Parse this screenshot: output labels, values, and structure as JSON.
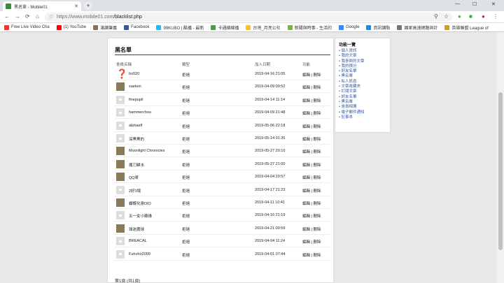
{
  "browser": {
    "tab_title": "黑名單 - Mobile01",
    "tab_close": "✕",
    "new_tab": "+",
    "url_host": "https://www.mobile01.com",
    "url_path": "/blacklist.php",
    "win_min": "—",
    "win_max": "☐",
    "win_close": "✕",
    "back": "←",
    "forward": "→",
    "reload": "⟳",
    "home": "⌂",
    "lock": "ⓘ"
  },
  "bookmarks": [
    {
      "label": "Free Live Video Cha",
      "color": "#e53935"
    },
    {
      "label": "(1) YouTube",
      "color": "#ff0000"
    },
    {
      "label": "滿讀筆義",
      "color": "#8d6e63"
    },
    {
      "label": "Facebook",
      "color": "#3b5998"
    },
    {
      "label": "99KUBO | 酷播 - 最新",
      "color": "#29b6f6"
    },
    {
      "label": "卡通線線播",
      "color": "#43a047"
    },
    {
      "label": "台灣_月亮公社",
      "color": "#fbc02d"
    },
    {
      "label": "新聞與時事 - 生活的",
      "color": "#7cb342"
    },
    {
      "label": "Google",
      "color": "#4285f4"
    },
    {
      "label": "資訊讀點",
      "color": "#1e88e5"
    },
    {
      "label": "國家高速網路與計",
      "color": "#757575"
    },
    {
      "label": "英雄聯盟 League of",
      "color": "#c9a227"
    }
  ],
  "main": {
    "title": "黑名單",
    "col_member": "會員名稱",
    "col_type": "類型",
    "col_added": "加入日期",
    "col_action": "功能",
    "rows": [
      {
        "name": "ho520",
        "type": "拒絕",
        "date": "2019-04-16 21:05",
        "actions": "編輯 | 刪除",
        "avatar": "question"
      },
      {
        "name": "xaeken",
        "type": "拒絕",
        "date": "2019-04-09 09:52",
        "actions": "編輯 | 刪除",
        "avatar": "image"
      },
      {
        "name": "finepupil",
        "type": "拒絕",
        "date": "2019-04-14 11:14",
        "actions": "編輯 | 刪除",
        "avatar": "default"
      },
      {
        "name": "hammerchou",
        "type": "拒絕",
        "date": "2019-04-09 21:48",
        "actions": "編輯 | 刪除",
        "avatar": "default"
      },
      {
        "name": "alphaelf",
        "type": "拒絕",
        "date": "2019-05-06 22:18",
        "actions": "編輯 | 刪除",
        "avatar": "default"
      },
      {
        "name": "深黑黑的",
        "type": "拒絕",
        "date": "2019-05-14 01:35",
        "actions": "編輯 | 刪除",
        "avatar": "default"
      },
      {
        "name": "Moonlight Chronicles",
        "type": "拒絕",
        "date": "2019-05-27 20:10",
        "actions": "編輯 | 刪除",
        "avatar": "image"
      },
      {
        "name": "擺刀歸水",
        "type": "拒絕",
        "date": "2019-05-27 21:00",
        "actions": "編輯 | 刪除",
        "avatar": "image"
      },
      {
        "name": "QQ哥",
        "type": "拒絕",
        "date": "2019-04-04 20:57",
        "actions": "編輯 | 刪除",
        "avatar": "image"
      },
      {
        "name": "2好3壞",
        "type": "拒絕",
        "date": "2019-04-17 21:23",
        "actions": "編輯 | 刪除",
        "avatar": "default"
      },
      {
        "name": "蝴蝶化身DIO",
        "type": "拒絕",
        "date": "2019-04-11 10:41",
        "actions": "編輯 | 刪除",
        "avatar": "image"
      },
      {
        "name": "五一女小蘇綠",
        "type": "拒絕",
        "date": "2019-04-16 21:19",
        "actions": "編輯 | 刪除",
        "avatar": "default"
      },
      {
        "name": "球迷農球",
        "type": "拒絕",
        "date": "2019-04-21 00:59",
        "actions": "編輯 | 刪除",
        "avatar": "image"
      },
      {
        "name": "BREACAL",
        "type": "拒絕",
        "date": "2019-04-04 11:24",
        "actions": "編輯 | 刪除",
        "avatar": "default"
      },
      {
        "name": "Fuhoho2099",
        "type": "拒絕",
        "date": "2019-04-01 07:44",
        "actions": "編輯 | 刪除",
        "avatar": "default"
      }
    ],
    "footer": "第1頁 (共1頁)"
  },
  "sidebar": {
    "title": "功能一覽",
    "items": [
      "個人資訊",
      "我的文章",
      "我參與的文章",
      "我的積分",
      "好友名單",
      "黑名單",
      "私人訊息",
      "文章收藏夾",
      "訂閱文章",
      "好友名單",
      "黑名單",
      "會員相簿",
      "電子郵件通知",
      "記事本"
    ]
  }
}
